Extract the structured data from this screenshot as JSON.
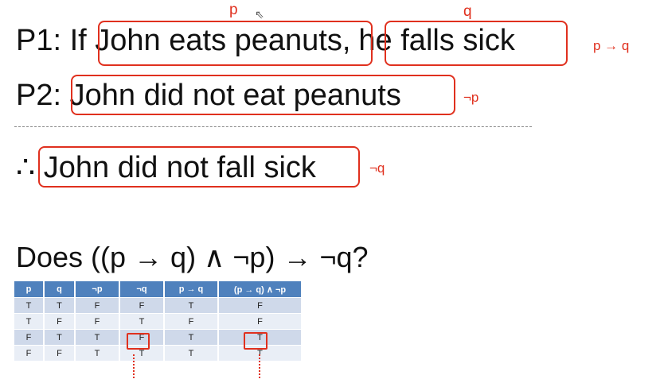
{
  "p1": {
    "label": "P1: If ",
    "clause_p": "John eats peanuts",
    "comma": ",",
    "clause_q": "he falls sick"
  },
  "p2": {
    "label": "P2: ",
    "clause": "John did not eat peanuts"
  },
  "conclusion": {
    "symbol": "∴ ",
    "clause": "John did not fall sick"
  },
  "annotations": {
    "p_label": "p",
    "q_label": "q",
    "p1_formula": "p → q",
    "p2_formula": "¬p",
    "conclusion_formula": "¬q"
  },
  "question": "Does ((p → q) ∧ ¬p) → ¬q?",
  "truth_table": {
    "headers": [
      "p",
      "q",
      "¬p",
      "¬q",
      "p → q",
      "(p → q) ∧ ¬p"
    ],
    "rows": [
      [
        "T",
        "T",
        "F",
        "F",
        "T",
        "F"
      ],
      [
        "T",
        "F",
        "F",
        "T",
        "F",
        "F"
      ],
      [
        "F",
        "T",
        "T",
        "F",
        "T",
        "T"
      ],
      [
        "F",
        "F",
        "T",
        "T",
        "T",
        "T"
      ]
    ],
    "highlighted_row": 3
  },
  "colors": {
    "accent": "#e0301e",
    "header": "#4f81bd",
    "row_dark": "#cfd9ea",
    "row_light": "#e9eef6"
  }
}
